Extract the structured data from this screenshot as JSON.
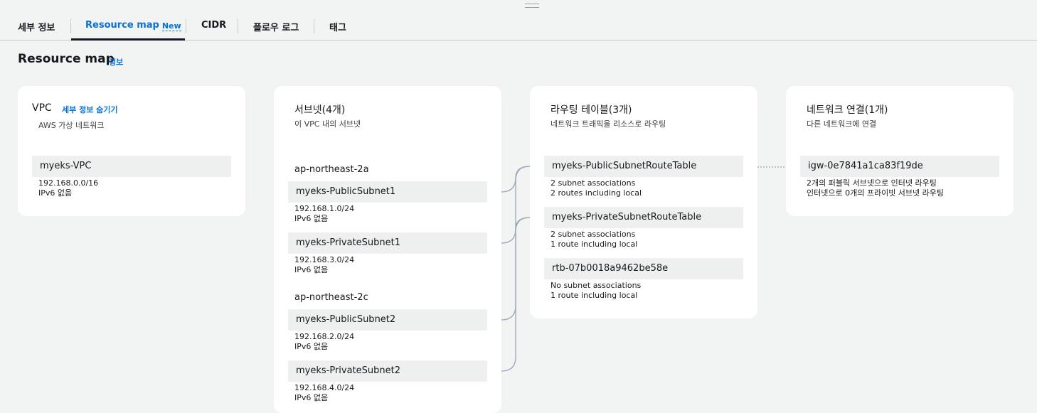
{
  "tabs": [
    {
      "label": "세부 정보"
    },
    {
      "label": "Resource map",
      "badge": "New"
    },
    {
      "label": "CIDR"
    },
    {
      "label": "플로우 로그"
    },
    {
      "label": "태그"
    }
  ],
  "page": {
    "title": "Resource map",
    "info_link": "정보"
  },
  "vpc": {
    "title": "VPC",
    "toggle_label": "세부 정보 숨기기",
    "subtitle": "AWS 가상 네트워크",
    "name": "myeks-VPC",
    "cidr": "192.168.0.0/16",
    "ipv6": "IPv6 없음"
  },
  "subnets": {
    "title": "서브넷(4개)",
    "subtitle": "이 VPC 내의 서브넷",
    "groups": [
      {
        "az": "ap-northeast-2a",
        "items": [
          {
            "name": "myeks-PublicSubnet1",
            "cidr": "192.168.1.0/24",
            "ipv6": "IPv6 없음"
          },
          {
            "name": "myeks-PrivateSubnet1",
            "cidr": "192.168.3.0/24",
            "ipv6": "IPv6 없음"
          }
        ]
      },
      {
        "az": "ap-northeast-2c",
        "items": [
          {
            "name": "myeks-PublicSubnet2",
            "cidr": "192.168.2.0/24",
            "ipv6": "IPv6 없음"
          },
          {
            "name": "myeks-PrivateSubnet2",
            "cidr": "192.168.4.0/24",
            "ipv6": "IPv6 없음"
          }
        ]
      }
    ]
  },
  "route_tables": {
    "title": "라우팅 테이블(3개)",
    "subtitle": "네트워크 트래픽을 리소스로 라우팅",
    "items": [
      {
        "name": "myeks-PublicSubnetRouteTable",
        "line1": "2 subnet associations",
        "line2": "2 routes including local"
      },
      {
        "name": "myeks-PrivateSubnetRouteTable",
        "line1": "2 subnet associations",
        "line2": "1 route including local"
      },
      {
        "name": "rtb-07b0018a9462be58e",
        "line1": "No subnet associations",
        "line2": "1 route including local"
      }
    ]
  },
  "network": {
    "title": "네트워크 연결(1개)",
    "subtitle": "다른 네트워크에 연결",
    "items": [
      {
        "name": "igw-0e7841a1ca83f19de",
        "line1": "2개의 퍼블릭 서브넷으로 인터넷 라우팅",
        "line2": "인터넷으로 0개의 프라이빗 서브넷 라우팅"
      }
    ]
  },
  "colors": {
    "accent": "#0972d3",
    "background": "#f2f3f3",
    "card": "#ffffff",
    "pill": "#eef0f0",
    "connector": "#9ba7b6"
  }
}
